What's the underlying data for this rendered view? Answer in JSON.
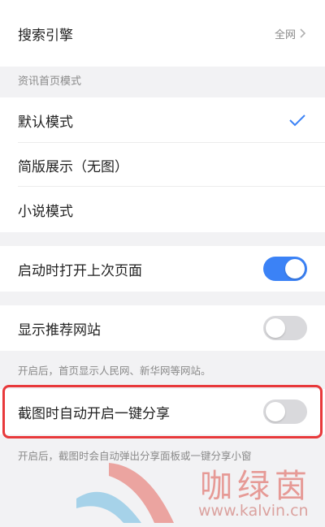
{
  "search_engine": {
    "label": "搜索引擎",
    "value": "全网"
  },
  "news_home_mode": {
    "section_title": "资讯首页模式",
    "options": [
      {
        "label": "默认模式",
        "selected": true
      },
      {
        "label": "简版展示（无图）",
        "selected": false
      },
      {
        "label": "小说模式",
        "selected": false
      }
    ]
  },
  "open_last_page": {
    "label": "启动时打开上次页面",
    "enabled": true
  },
  "show_recommended_sites": {
    "label": "显示推荐网站",
    "enabled": false,
    "hint": "开启后，首页显示人民网、新华网等网站。"
  },
  "screenshot_share": {
    "label": "截图时自动开启一键分享",
    "enabled": false,
    "hint": "开启后，截图时会自动弹出分享面板或一键分享小窗"
  },
  "watermark": {
    "text": "咖绿茵",
    "url": "www.kalvin.cn"
  },
  "colors": {
    "accent": "#3b82f6",
    "check": "#3b82f6",
    "highlight": "#e8393b",
    "toggle_off": "#d9d9dc"
  }
}
